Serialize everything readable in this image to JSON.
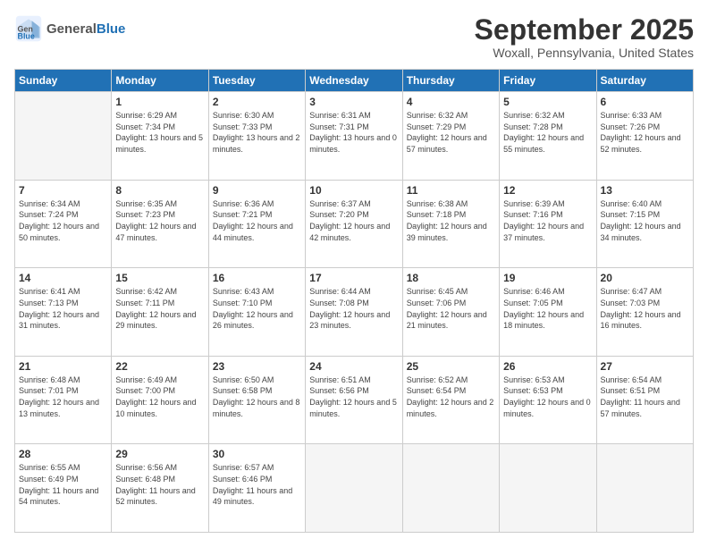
{
  "header": {
    "logo_general": "General",
    "logo_blue": "Blue",
    "month": "September 2025",
    "location": "Woxall, Pennsylvania, United States"
  },
  "days_of_week": [
    "Sunday",
    "Monday",
    "Tuesday",
    "Wednesday",
    "Thursday",
    "Friday",
    "Saturday"
  ],
  "weeks": [
    [
      {
        "day": "",
        "empty": true
      },
      {
        "day": "1",
        "sunrise": "6:29 AM",
        "sunset": "7:34 PM",
        "daylight": "13 hours and 5 minutes."
      },
      {
        "day": "2",
        "sunrise": "6:30 AM",
        "sunset": "7:33 PM",
        "daylight": "13 hours and 2 minutes."
      },
      {
        "day": "3",
        "sunrise": "6:31 AM",
        "sunset": "7:31 PM",
        "daylight": "13 hours and 0 minutes."
      },
      {
        "day": "4",
        "sunrise": "6:32 AM",
        "sunset": "7:29 PM",
        "daylight": "12 hours and 57 minutes."
      },
      {
        "day": "5",
        "sunrise": "6:32 AM",
        "sunset": "7:28 PM",
        "daylight": "12 hours and 55 minutes."
      },
      {
        "day": "6",
        "sunrise": "6:33 AM",
        "sunset": "7:26 PM",
        "daylight": "12 hours and 52 minutes."
      }
    ],
    [
      {
        "day": "7",
        "sunrise": "6:34 AM",
        "sunset": "7:24 PM",
        "daylight": "12 hours and 50 minutes."
      },
      {
        "day": "8",
        "sunrise": "6:35 AM",
        "sunset": "7:23 PM",
        "daylight": "12 hours and 47 minutes."
      },
      {
        "day": "9",
        "sunrise": "6:36 AM",
        "sunset": "7:21 PM",
        "daylight": "12 hours and 44 minutes."
      },
      {
        "day": "10",
        "sunrise": "6:37 AM",
        "sunset": "7:20 PM",
        "daylight": "12 hours and 42 minutes."
      },
      {
        "day": "11",
        "sunrise": "6:38 AM",
        "sunset": "7:18 PM",
        "daylight": "12 hours and 39 minutes."
      },
      {
        "day": "12",
        "sunrise": "6:39 AM",
        "sunset": "7:16 PM",
        "daylight": "12 hours and 37 minutes."
      },
      {
        "day": "13",
        "sunrise": "6:40 AM",
        "sunset": "7:15 PM",
        "daylight": "12 hours and 34 minutes."
      }
    ],
    [
      {
        "day": "14",
        "sunrise": "6:41 AM",
        "sunset": "7:13 PM",
        "daylight": "12 hours and 31 minutes."
      },
      {
        "day": "15",
        "sunrise": "6:42 AM",
        "sunset": "7:11 PM",
        "daylight": "12 hours and 29 minutes."
      },
      {
        "day": "16",
        "sunrise": "6:43 AM",
        "sunset": "7:10 PM",
        "daylight": "12 hours and 26 minutes."
      },
      {
        "day": "17",
        "sunrise": "6:44 AM",
        "sunset": "7:08 PM",
        "daylight": "12 hours and 23 minutes."
      },
      {
        "day": "18",
        "sunrise": "6:45 AM",
        "sunset": "7:06 PM",
        "daylight": "12 hours and 21 minutes."
      },
      {
        "day": "19",
        "sunrise": "6:46 AM",
        "sunset": "7:05 PM",
        "daylight": "12 hours and 18 minutes."
      },
      {
        "day": "20",
        "sunrise": "6:47 AM",
        "sunset": "7:03 PM",
        "daylight": "12 hours and 16 minutes."
      }
    ],
    [
      {
        "day": "21",
        "sunrise": "6:48 AM",
        "sunset": "7:01 PM",
        "daylight": "12 hours and 13 minutes."
      },
      {
        "day": "22",
        "sunrise": "6:49 AM",
        "sunset": "7:00 PM",
        "daylight": "12 hours and 10 minutes."
      },
      {
        "day": "23",
        "sunrise": "6:50 AM",
        "sunset": "6:58 PM",
        "daylight": "12 hours and 8 minutes."
      },
      {
        "day": "24",
        "sunrise": "6:51 AM",
        "sunset": "6:56 PM",
        "daylight": "12 hours and 5 minutes."
      },
      {
        "day": "25",
        "sunrise": "6:52 AM",
        "sunset": "6:54 PM",
        "daylight": "12 hours and 2 minutes."
      },
      {
        "day": "26",
        "sunrise": "6:53 AM",
        "sunset": "6:53 PM",
        "daylight": "12 hours and 0 minutes."
      },
      {
        "day": "27",
        "sunrise": "6:54 AM",
        "sunset": "6:51 PM",
        "daylight": "11 hours and 57 minutes."
      }
    ],
    [
      {
        "day": "28",
        "sunrise": "6:55 AM",
        "sunset": "6:49 PM",
        "daylight": "11 hours and 54 minutes."
      },
      {
        "day": "29",
        "sunrise": "6:56 AM",
        "sunset": "6:48 PM",
        "daylight": "11 hours and 52 minutes."
      },
      {
        "day": "30",
        "sunrise": "6:57 AM",
        "sunset": "6:46 PM",
        "daylight": "11 hours and 49 minutes."
      },
      {
        "day": "",
        "empty": true
      },
      {
        "day": "",
        "empty": true
      },
      {
        "day": "",
        "empty": true
      },
      {
        "day": "",
        "empty": true
      }
    ]
  ],
  "labels": {
    "sunrise": "Sunrise:",
    "sunset": "Sunset:",
    "daylight": "Daylight:"
  }
}
